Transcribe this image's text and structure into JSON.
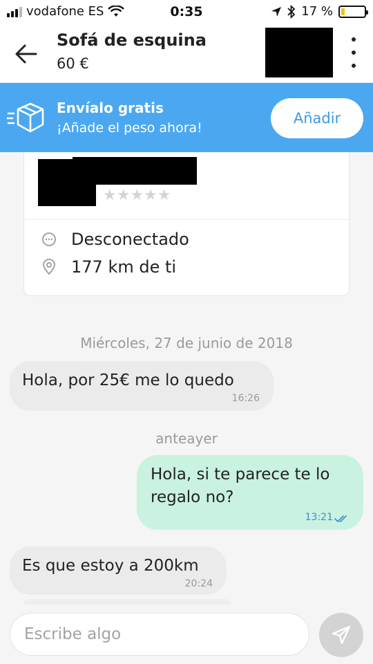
{
  "status_bar": {
    "carrier": "vodafone ES",
    "time": "0:35",
    "battery_text": "17 %",
    "battery_level": 0.17
  },
  "header": {
    "title": "Sofá de esquina",
    "price": "60 €"
  },
  "shipping_banner": {
    "title": "Envíalo gratis",
    "subtitle": "¡Añade el peso ahora!",
    "button_label": "Añadir"
  },
  "seller": {
    "rating_stars": "★★★★★",
    "rating_value": 0,
    "status": "Desconectado",
    "distance": "177 km de ti"
  },
  "chat": {
    "date_1": "Miércoles, 27 de junio de 2018",
    "date_2": "anteayer",
    "messages": [
      {
        "direction": "in",
        "text": "Hola, por 25€ me lo quedo",
        "time": "16:26"
      },
      {
        "direction": "out",
        "text": "Hola, si te parece te lo regalo no?",
        "time": "13:21"
      },
      {
        "direction": "in",
        "text": "Es que estoy a 200km",
        "time": "20:24"
      }
    ]
  },
  "composer": {
    "placeholder": "Escribe algo"
  },
  "colors": {
    "banner": "#4ba8f0",
    "outgoing_bubble": "#c9f2e0",
    "incoming_bubble": "#ebebeb"
  }
}
